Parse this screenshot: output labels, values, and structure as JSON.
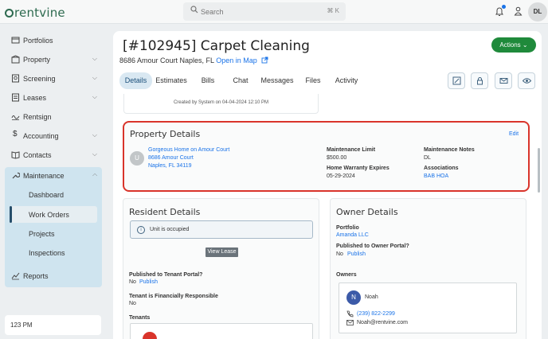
{
  "brand": {
    "logo_text": "rentvine"
  },
  "search": {
    "placeholder": "Search",
    "shortcut": "⌘ K"
  },
  "user": {
    "initials": "DL"
  },
  "sidebar": {
    "items": [
      {
        "label": "Portfolios",
        "icon": "folder-icon"
      },
      {
        "label": "Property",
        "icon": "building-icon"
      },
      {
        "label": "Screening",
        "icon": "screening-icon"
      },
      {
        "label": "Leases",
        "icon": "lease-icon"
      },
      {
        "label": "Rentsign",
        "icon": "signature-icon"
      },
      {
        "label": "Accounting",
        "icon": "dollar-icon"
      },
      {
        "label": "Contacts",
        "icon": "book-icon"
      },
      {
        "label": "Maintenance",
        "icon": "wrench-icon"
      },
      {
        "label": "Reports",
        "icon": "chart-icon"
      }
    ],
    "maintenance_sub": [
      "Dashboard",
      "Work Orders",
      "Projects",
      "Inspections"
    ],
    "clock": "123 PM"
  },
  "header": {
    "title": "[#102945] Carpet Cleaning",
    "address": "8686 Amour Court Naples, FL",
    "open_map": "Open in Map",
    "actions_label": "Actions"
  },
  "tabs": [
    "Details",
    "Estimates",
    "Bills",
    "Chat",
    "Messages",
    "Files",
    "Activity"
  ],
  "toolbar_icons": [
    "edit-icon",
    "lock-icon",
    "mail-icon",
    "eye-icon"
  ],
  "created_text": "Created by System on 04-04-2024 12:10 PM",
  "property_details": {
    "title": "Property Details",
    "edit": "Edit",
    "avatar_letter": "U",
    "property_name": "Gorgeous Home on Amour Court",
    "street": "8686 Amour Court",
    "city": "Naples, FL 34119",
    "maintenance_limit_label": "Maintenance Limit",
    "maintenance_limit": "$500.00",
    "home_warranty_label": "Home Warranty Expires",
    "home_warranty": "05-29-2024",
    "maintenance_notes_label": "Maintenance Notes",
    "maintenance_notes": "DL",
    "associations_label": "Associations",
    "associations": "BAB HOA"
  },
  "resident_details": {
    "title": "Resident Details",
    "notice": "Unit is occupied",
    "view_lease": "View Lease",
    "tenant_portal_label": "Published to Tenant Portal?",
    "tenant_portal_value": "No",
    "tenant_portal_action": "Publish",
    "financially_label": "Tenant is Financially Responsible",
    "financially_value": "No",
    "tenants_label": "Tenants"
  },
  "owner_details": {
    "title": "Owner Details",
    "portfolio_label": "Portfolio",
    "portfolio": "Amanda LLC",
    "owner_portal_label": "Published to Owner Portal?",
    "owner_portal_value": "No",
    "owner_portal_action": "Publish",
    "owners_label": "Owners",
    "owner_initial": "N",
    "owner_name": "Noah",
    "owner_phone": "(239) 822-2299",
    "owner_email": "Noah@rentvine.com"
  },
  "colors": {
    "brand_green": "#2d6a4f",
    "link_blue": "#1a73e8",
    "highlight_red": "#d9342b",
    "actions_green": "#1f8a3b"
  }
}
